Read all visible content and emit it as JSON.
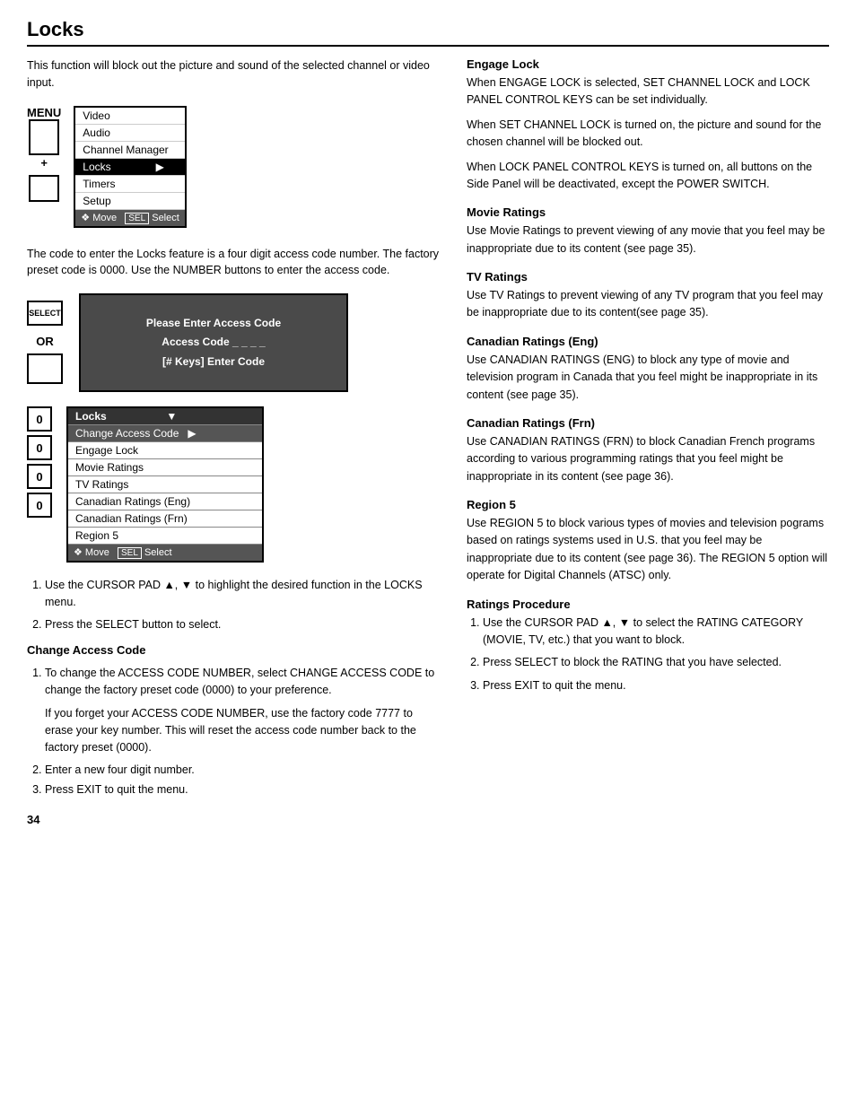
{
  "page": {
    "title": "Locks",
    "number": "34"
  },
  "left": {
    "intro": "This function will block out the picture and sound of the selected channel or video input.",
    "menu_label": "MENU",
    "menu_items": [
      {
        "label": "Video",
        "selected": false,
        "arrow": false
      },
      {
        "label": "Audio",
        "selected": false,
        "arrow": false
      },
      {
        "label": "Channel Manager",
        "selected": false,
        "arrow": false
      },
      {
        "label": "Locks",
        "selected": true,
        "arrow": true
      },
      {
        "label": "Timers",
        "selected": false,
        "arrow": false
      },
      {
        "label": "Setup",
        "selected": false,
        "arrow": false
      }
    ],
    "menu_footer": "Move",
    "menu_footer_sel": "SEL",
    "menu_footer_select": "Select",
    "code_text": "The code to enter the Locks feature is a four digit access code number. The factory preset code is 0000. Use the NUMBER buttons to enter the access code.",
    "dark_panel": {
      "line1": "Please Enter Access Code",
      "line2": "Access Code _ _ _ _",
      "line3": "[# Keys] Enter Code"
    },
    "locks_menu_title": "Locks",
    "locks_items": [
      {
        "label": "Change Access Code",
        "arrow": true
      },
      {
        "label": "Engage Lock",
        "arrow": false
      },
      {
        "label": "Movie Ratings",
        "arrow": false
      },
      {
        "label": "TV Ratings",
        "arrow": false
      },
      {
        "label": "Canadian Ratings (Eng)",
        "arrow": false
      },
      {
        "label": "Canadian Ratings (Frn)",
        "arrow": false
      },
      {
        "label": "Region 5",
        "arrow": false
      }
    ],
    "locks_footer_move": "Move",
    "locks_footer_sel": "SEL",
    "locks_footer_select": "Select",
    "steps_cursor": "Use the CURSOR PAD ▲, ▼ to highlight the desired function in the LOCKS menu.",
    "steps_select": "Press the SELECT button to select.",
    "change_access_heading": "Change Access Code",
    "change_access_steps": [
      "To change the ACCESS CODE NUMBER, select CHANGE ACCESS CODE to change the factory preset code (0000) to your preference.",
      "If you forget your ACCESS CODE NUMBER, use the factory code 7777 to erase your key number. This will reset the access code number back to the factory preset (0000).",
      "Enter a new four digit number.",
      "Press EXIT to quit the menu."
    ],
    "change_access_step2_label": "Enter a new four digit number.",
    "change_access_step3_label": "Press EXIT to quit the menu."
  },
  "right": {
    "sections": [
      {
        "title": "Engage Lock",
        "paras": [
          "When ENGAGE LOCK is selected, SET CHANNEL LOCK and LOCK PANEL CONTROL KEYS can be set individually.",
          "When SET CHANNEL LOCK is turned on, the picture and sound for the chosen channel will be blocked out.",
          "When LOCK PANEL CONTROL KEYS is turned on, all buttons on the Side Panel will be deactivated, except the POWER SWITCH."
        ]
      },
      {
        "title": "Movie Ratings",
        "paras": [
          "Use Movie Ratings to prevent viewing of any movie that you feel may be inappropriate due to its content (see page 35)."
        ]
      },
      {
        "title": "TV Ratings",
        "paras": [
          "Use TV Ratings to prevent viewing of any TV program that you feel may be inappropriate due to its content(see page 35)."
        ]
      },
      {
        "title": "Canadian Ratings (Eng)",
        "paras": [
          "Use CANADIAN RATINGS (ENG) to block any type of movie and television program in Canada that you feel might be inappropriate in its content (see page 35)."
        ]
      },
      {
        "title": "Canadian Ratings (Frn)",
        "paras": [
          "Use CANADIAN RATINGS (FRN) to block Canadian French programs according to various programming ratings that you feel might be inappropriate in its content (see page 36)."
        ]
      },
      {
        "title": "Region 5",
        "paras": [
          "Use REGION 5 to block various types of movies and television pograms based on ratings systems used in U.S. that you feel may be inappropriate due to its content (see page 36). The REGION 5 option will operate for Digital Channels (ATSC) only."
        ]
      },
      {
        "title": "Ratings Procedure",
        "steps": [
          "Use the CURSOR PAD ▲, ▼ to select the RATING CATEGORY (MOVIE, TV, etc.) that you want to block.",
          "Press SELECT to block the RATING that you have selected.",
          "Press EXIT to quit the menu."
        ]
      }
    ]
  }
}
